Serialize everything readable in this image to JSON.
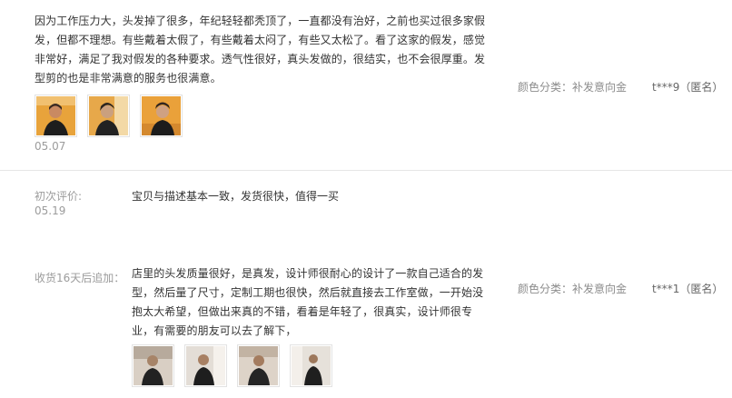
{
  "reviews": [
    {
      "text": "因为工作压力大，头发掉了很多，年纪轻轻都秃顶了，一直都没有治好，之前也买过很多家假发，但都不理想。有些戴着太假了，有些戴着太闷了，有些又太松了。看了这家的假发，感觉非常好，满足了我对假发的各种要求。透气性很好，真头发做的，很结实，也不会很厚重。发型剪的也是非常满意的服务也很满意。",
      "date": "05.07",
      "sku": "颜色分类：补发意向金",
      "user": "t***9（匿名）",
      "photo_count": 3
    }
  ],
  "review2": {
    "first_label": "初次评价:",
    "first_date": "05.19",
    "first_text": "宝贝与描述基本一致，发货很快，值得一买",
    "append_label": "收货16天后追加：",
    "append_text": "店里的头发质量很好，是真发，设计师很耐心的设计了一款自己适合的发型，然后量了尺寸，定制工期也很快，然后就直接去工作室做，一开始没抱太大希望，但做出来真的不错，看着是年轻了，很真实，设计师很专业，有需要的朋友可以去了解下，",
    "sku": "颜色分类：补发意向金",
    "user": "t***1（匿名）",
    "photo_count": 4
  }
}
